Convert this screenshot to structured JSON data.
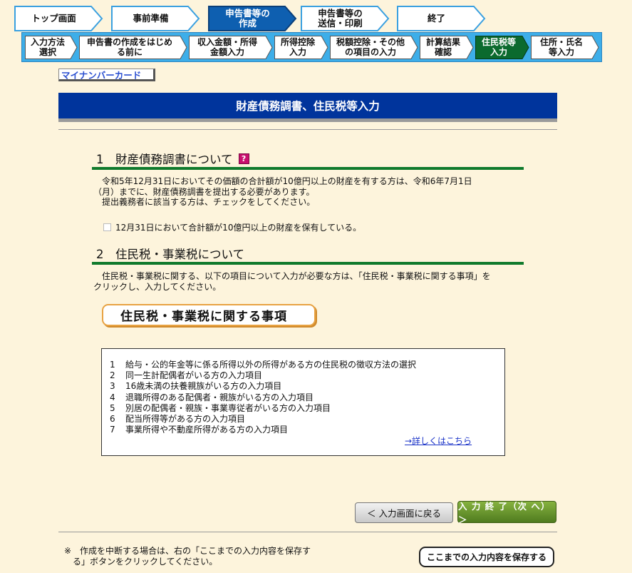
{
  "top_steps": [
    {
      "label": "トップ画面",
      "active": false
    },
    {
      "label": "事前準備",
      "active": false
    },
    {
      "label": "申告書等の\n作成",
      "active": true
    },
    {
      "label": "申告書等の\n送信・印刷",
      "active": false
    },
    {
      "label": "終了",
      "active": false
    }
  ],
  "sub_steps": [
    {
      "label": "入力方法\n選択",
      "active": false
    },
    {
      "label": "申告書の作成をはじめ\nる前に",
      "active": false
    },
    {
      "label": "収入金額・所得\n金額入力",
      "active": false
    },
    {
      "label": "所得控除\n入力",
      "active": false
    },
    {
      "label": "税額控除・その他\nの項目の入力",
      "active": false
    },
    {
      "label": "計算結果\n確認",
      "active": false
    },
    {
      "label": "住民税等\n入力",
      "active": true
    },
    {
      "label": "住所・氏名\n等入力",
      "active": false
    }
  ],
  "mynumber_label": "マイナンバーカード",
  "page_title": "財産債務調書、住民税等入力",
  "section1": {
    "title": "1　財産債務調書について",
    "help_icon": "?",
    "paragraph": "　令和5年12月31日においてその価額の合計額が10億円以上の財産を有する方は、令和6年7月1日\n（月）までに、財産債務調書を提出する必要があります。\n　提出義務者に該当する方は、チェックをしてください。",
    "checkbox_label": "12月31日において合計額が10億円以上の財産を保有している。",
    "checkbox_checked": false
  },
  "section2": {
    "title": "2　住民税・事業税について",
    "paragraph": "　住民税・事業税に関する、以下の項目について入力が必要な方は、「住民税・事業税に関する事項」を\nクリックし、入力してください。",
    "button_label": "住民税・事業税に関する事項",
    "items": [
      {
        "num": "1",
        "text": "給与・公的年金等に係る所得以外の所得がある方の住民税の徴収方法の選択"
      },
      {
        "num": "2",
        "text": "同一生計配偶者がいる方の入力項目"
      },
      {
        "num": "3",
        "text": "16歳未満の扶養親族がいる方の入力項目"
      },
      {
        "num": "4",
        "text": "退職所得のある配偶者・親族がいる方の入力項目"
      },
      {
        "num": "5",
        "text": "別居の配偶者・親族・事業専従者がいる方の入力項目"
      },
      {
        "num": "6",
        "text": "配当所得等がある方の入力項目"
      },
      {
        "num": "7",
        "text": "事業所得や不動産所得がある方の入力項目"
      }
    ],
    "detail_link": "→詳しくはこちら"
  },
  "buttons": {
    "back": "＜ 入力画面に戻る",
    "next": "入 力 終 了（次 へ）＞",
    "save": "ここまでの入力内容を保存する"
  },
  "note": "※　作成を中断する場合は、右の「ここまでの入力内容を保存す\n　る」ボタンをクリックしてください。",
  "colors": {
    "background": "#fdf4dc",
    "title_bar": "#00349c",
    "section_rule": "#0f7a2c",
    "sub_bar": "#3daee9",
    "active_step": "#0b6a2e",
    "next_button": "#5d8a26"
  }
}
